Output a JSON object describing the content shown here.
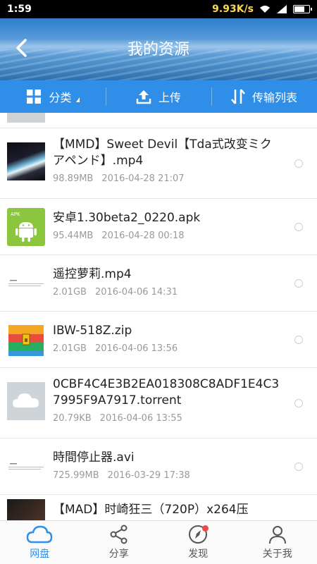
{
  "status_bar": {
    "time": "1:59",
    "network_speed": "9.93K/s"
  },
  "header": {
    "title": "我的资源"
  },
  "toolbar": {
    "category_label": "分类",
    "upload_label": "上传",
    "transfer_list_label": "传输列表"
  },
  "files": [
    {
      "name": "【MMD】Sweet Devil【Tda式改变ミク アペンド】.mp4",
      "size": "98.89MB",
      "date": "2016-04-28",
      "time": "21:07",
      "icon": "video-thumbnail"
    },
    {
      "name": "安卓1.30beta2_0220.apk",
      "size": "95.44MB",
      "date": "2016-04-28",
      "time": "00:18",
      "icon": "apk-icon",
      "icon_tag": "APK"
    },
    {
      "name": "遥控萝莉.mp4",
      "size": "2.01GB",
      "date": "2016-04-06",
      "time": "14:31",
      "icon": "document-thumbnail"
    },
    {
      "name": "IBW-518Z.zip",
      "size": "2.01GB",
      "date": "2016-04-06",
      "time": "13:56",
      "icon": "zip-icon"
    },
    {
      "name": "0CBF4C4E3B2EA018308C8ADF1E4C37995F9A7917.torrent",
      "size": "20.79KB",
      "date": "2016-04-06",
      "time": "13:55",
      "icon": "cloud-file-icon"
    },
    {
      "name": "時間停止器.avi",
      "size": "725.99MB",
      "date": "2016-03-29",
      "time": "17:38",
      "icon": "document-thumbnail"
    },
    {
      "name": "【MAD】时崎狂三（720P）x264压",
      "icon": "video-thumbnail"
    }
  ],
  "bottom_nav": [
    {
      "label": "网盘",
      "icon": "cloud-icon",
      "active": true
    },
    {
      "label": "分享",
      "icon": "share-icon",
      "active": false
    },
    {
      "label": "发现",
      "icon": "compass-icon",
      "active": false,
      "badge": true
    },
    {
      "label": "关于我",
      "icon": "person-icon",
      "active": false
    }
  ],
  "colors": {
    "accent": "#2f8ee8",
    "badge": "#f04848",
    "meta_text": "#9a9a9a"
  }
}
